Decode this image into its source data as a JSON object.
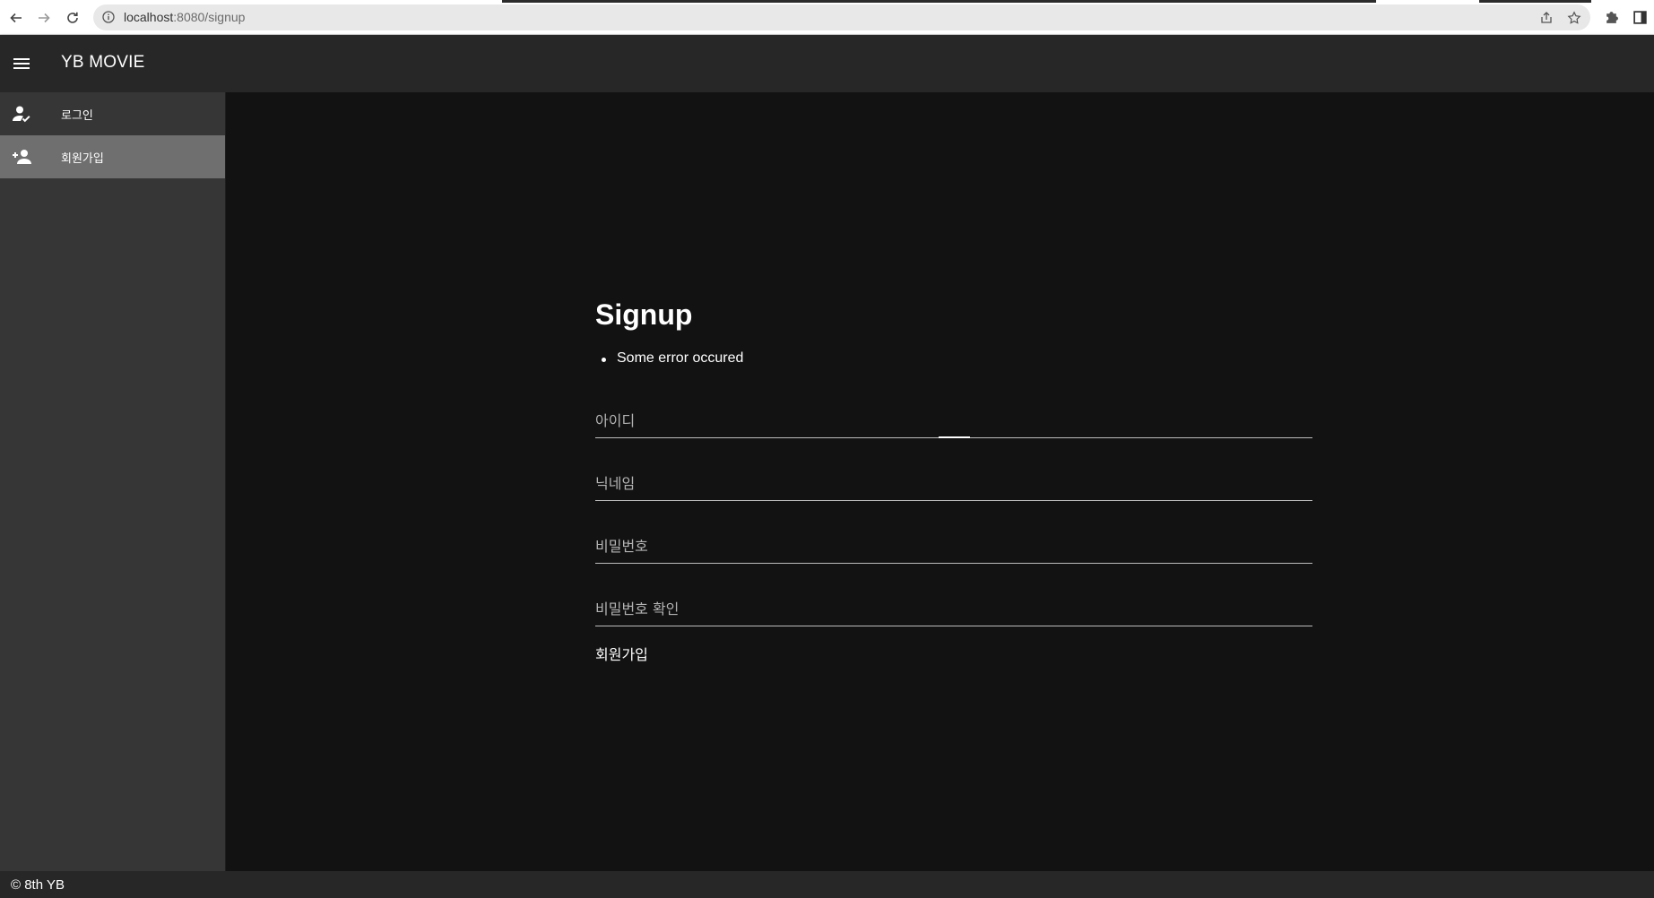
{
  "browser": {
    "url_host": "localhost",
    "url_path": ":8080/signup"
  },
  "appbar": {
    "title": "YB MOVIE"
  },
  "sidebar": {
    "items": [
      {
        "label": "로그인",
        "icon": "account-check-icon",
        "active": false
      },
      {
        "label": "회원가입",
        "icon": "account-plus-icon",
        "active": true
      }
    ]
  },
  "form": {
    "title": "Signup",
    "errors": [
      "Some error occured"
    ],
    "fields": {
      "id": {
        "placeholder": "아이디",
        "value": ""
      },
      "nickname": {
        "placeholder": "닉네임",
        "value": ""
      },
      "password": {
        "placeholder": "비밀번호",
        "value": ""
      },
      "password_confirm": {
        "placeholder": "비밀번호 확인",
        "value": ""
      }
    },
    "submit_label": "회원가입"
  },
  "footer": {
    "text": "© 8th YB"
  },
  "colors": {
    "background": "#121212",
    "appbar": "#272727",
    "sidebar": "#363636",
    "sidebar_active": "#6f6f6f"
  }
}
